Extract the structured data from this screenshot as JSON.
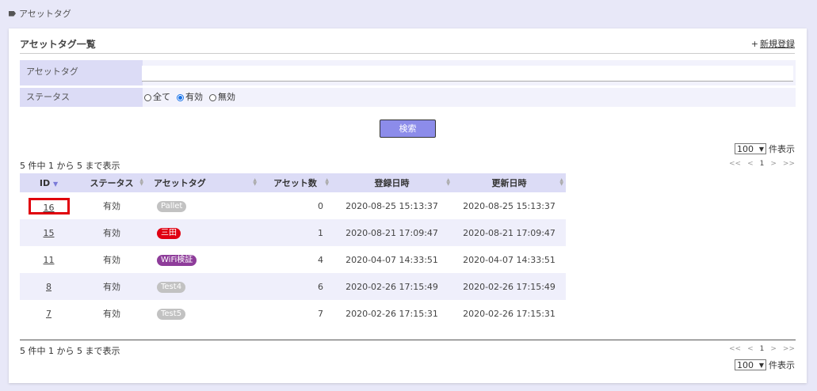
{
  "breadcrumb": {
    "label": "アセットタグ",
    "icon": "tag-icon"
  },
  "panel": {
    "title": "アセットタグ一覧",
    "new_link_plus": "+",
    "new_link": "新規登録"
  },
  "filters": {
    "asset_tag_label": "アセットタグ",
    "asset_tag_value": "",
    "status_label": "ステータス",
    "status_options": [
      {
        "label": "全て",
        "checked": false
      },
      {
        "label": "有効",
        "checked": true
      },
      {
        "label": "無効",
        "checked": false
      }
    ]
  },
  "search_button": "検索",
  "pagesize": {
    "value": "100",
    "suffix": "件表示"
  },
  "count_text": "5 件中 1 から 5 まで表示",
  "pager": {
    "first": "<<",
    "prev": "<",
    "page": "1",
    "next": ">",
    "last": ">>"
  },
  "table": {
    "headers": [
      "ID",
      "ステータス",
      "アセットタグ",
      "アセット数",
      "登録日時",
      "更新日時"
    ],
    "rows": [
      {
        "id": "16",
        "status": "有効",
        "tag": "Pallet",
        "tag_color": "#c2c2c2",
        "count": "0",
        "created": "2020-08-25 15:13:37",
        "updated": "2020-08-25 15:13:37"
      },
      {
        "id": "15",
        "status": "有効",
        "tag": "三田",
        "tag_color": "#e00012",
        "count": "1",
        "created": "2020-08-21 17:09:47",
        "updated": "2020-08-21 17:09:47"
      },
      {
        "id": "11",
        "status": "有効",
        "tag": "WiFi検証",
        "tag_color": "#8e3c9a",
        "count": "4",
        "created": "2020-04-07 14:33:51",
        "updated": "2020-04-07 14:33:51"
      },
      {
        "id": "8",
        "status": "有効",
        "tag": "Test4",
        "tag_color": "#c2c2c2",
        "count": "6",
        "created": "2020-02-26 17:15:49",
        "updated": "2020-02-26 17:15:49"
      },
      {
        "id": "7",
        "status": "有効",
        "tag": "Test5",
        "tag_color": "#c2c2c2",
        "count": "7",
        "created": "2020-02-26 17:15:31",
        "updated": "2020-02-26 17:15:31"
      }
    ]
  }
}
